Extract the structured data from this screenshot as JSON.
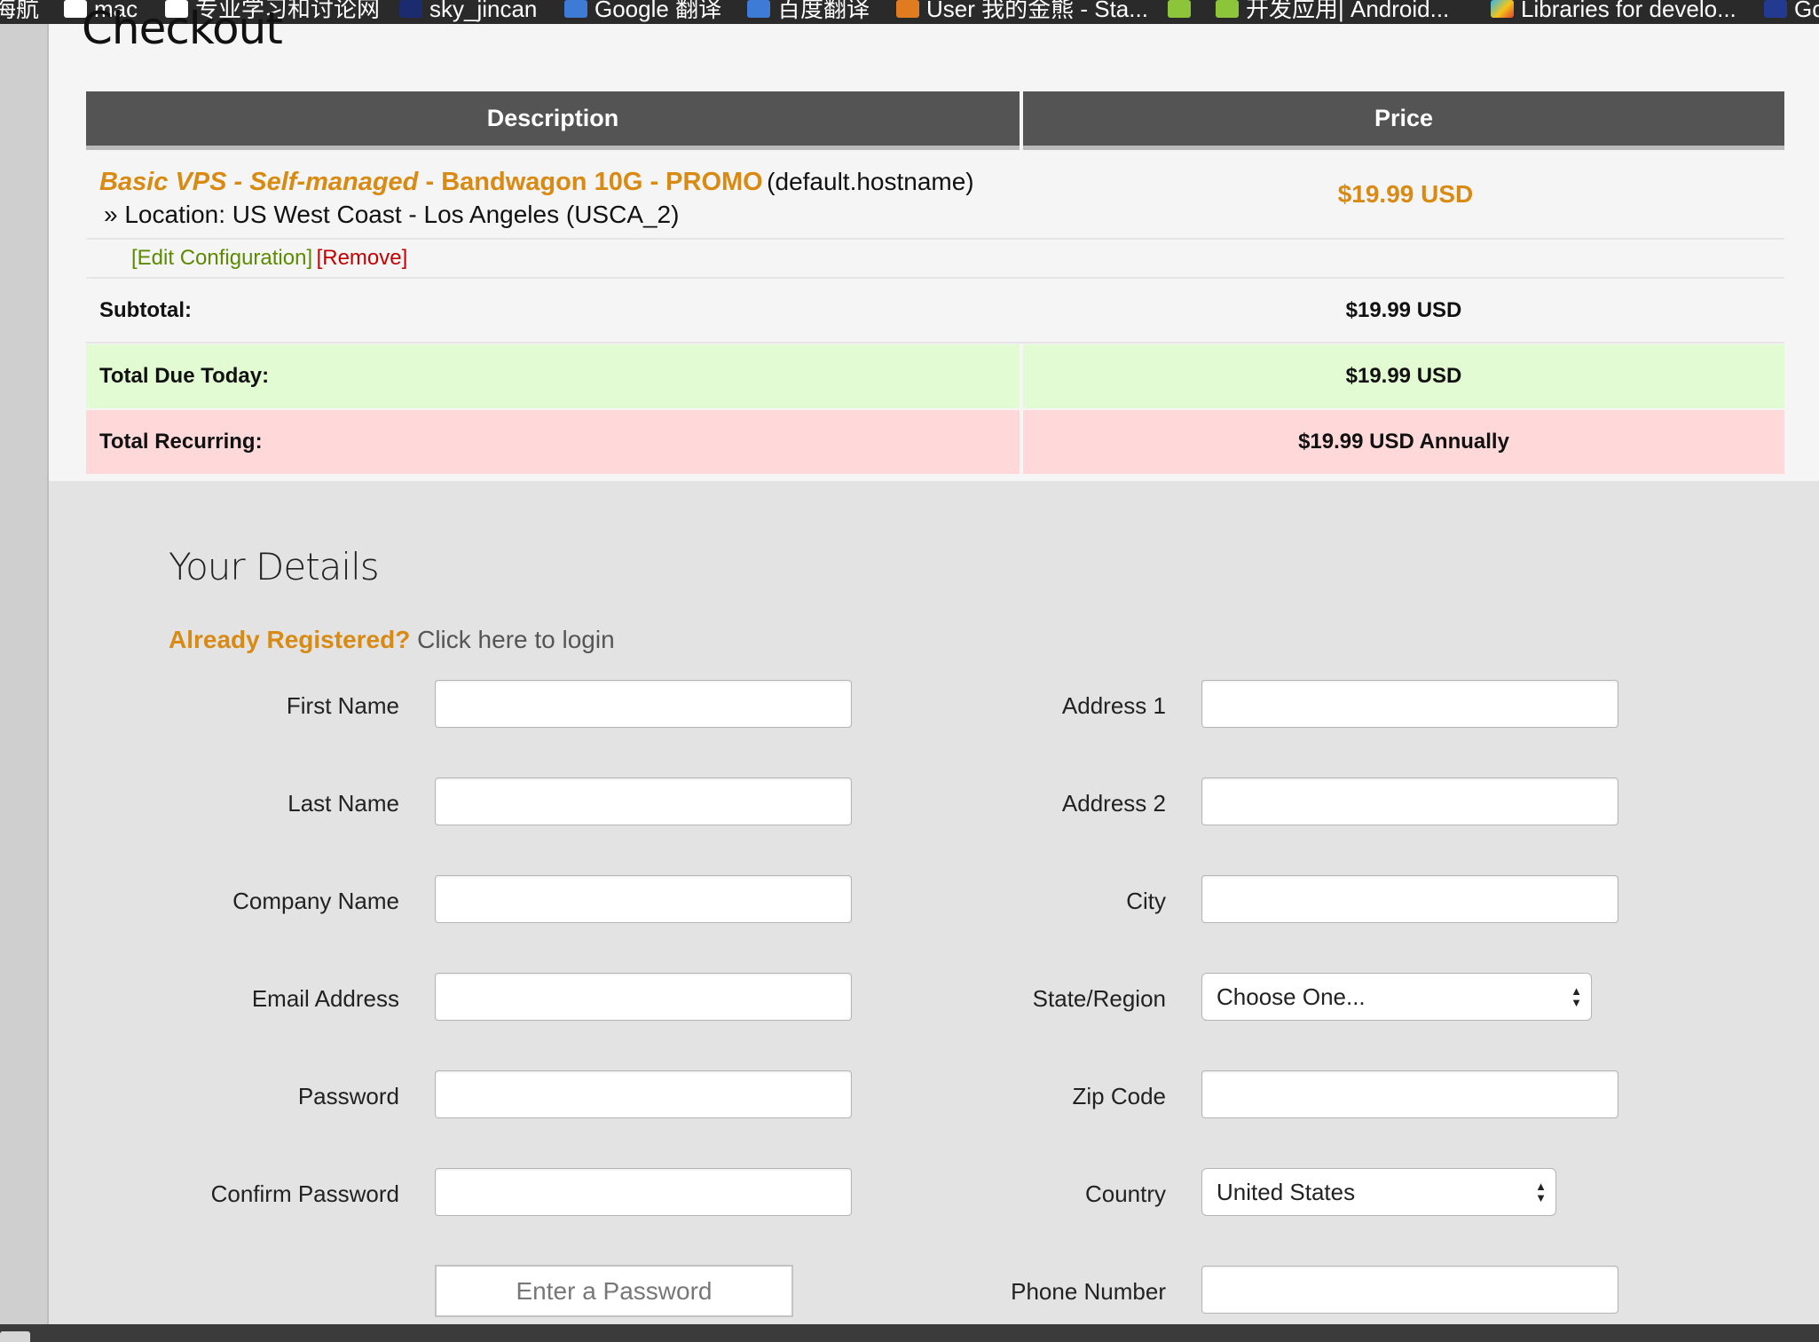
{
  "bookmarks": [
    {
      "label": "海航",
      "icon": "none"
    },
    {
      "label": "mac",
      "icon": "folder-icon"
    },
    {
      "label": "专业学习和讨论网",
      "icon": "folder-icon"
    },
    {
      "label": "sky_jincan",
      "icon": "bookmark-icon"
    },
    {
      "label": "Google 翻译",
      "icon": "google-translate-icon"
    },
    {
      "label": "百度翻译",
      "icon": "baidu-translate-icon"
    },
    {
      "label": "User 我的金熊 - Sta...",
      "icon": "stackoverflow-icon"
    },
    {
      "label": "",
      "icon": "android-icon"
    },
    {
      "label": "开发应用| Android...",
      "icon": "android-icon"
    },
    {
      "label": "Libraries for develo...",
      "icon": "play-icon"
    },
    {
      "label": "Go",
      "icon": "go-icon"
    }
  ],
  "page": {
    "title": "Checkout"
  },
  "cart": {
    "headers": {
      "description": "Description",
      "price": "Price"
    },
    "item": {
      "name_part1": "Basic VPS - Self-managed",
      "name_sep": " - ",
      "name_part2": "Bandwagon 10G - PROMO",
      "hostname": "(default.hostname)",
      "location": "» Location: US West Coast - Los Angeles (USCA_2)",
      "price": "$19.99 USD",
      "edit_label": "[Edit Configuration]",
      "remove_label": "[Remove]"
    },
    "subtotal": {
      "label": "Subtotal:",
      "value": "$19.99 USD"
    },
    "total_due": {
      "label": "Total Due Today:",
      "value": "$19.99 USD"
    },
    "recurring": {
      "label": "Total Recurring:",
      "value": "$19.99 USD Annually"
    }
  },
  "details": {
    "title": "Your Details",
    "already_registered": "Already Registered?",
    "login_link": "Click here to login",
    "left_fields": {
      "first_name": "First Name",
      "last_name": "Last Name",
      "company_name": "Company Name",
      "email": "Email Address",
      "password": "Password",
      "confirm_password": "Confirm Password"
    },
    "right_fields": {
      "address1": "Address 1",
      "address2": "Address 2",
      "city": "City",
      "state": "State/Region",
      "zip": "Zip Code",
      "country": "Country",
      "phone": "Phone Number"
    },
    "state_selected": "Choose One...",
    "country_selected": "United States",
    "password_button": "Enter a Password"
  },
  "colors": {
    "accent_orange": "#d88a12",
    "edit_green": "#5c8a00",
    "remove_red": "#c40000",
    "total_due_bg": "#e3fbd2",
    "recurring_bg": "#ffd9d9",
    "header_bg": "#545454"
  }
}
